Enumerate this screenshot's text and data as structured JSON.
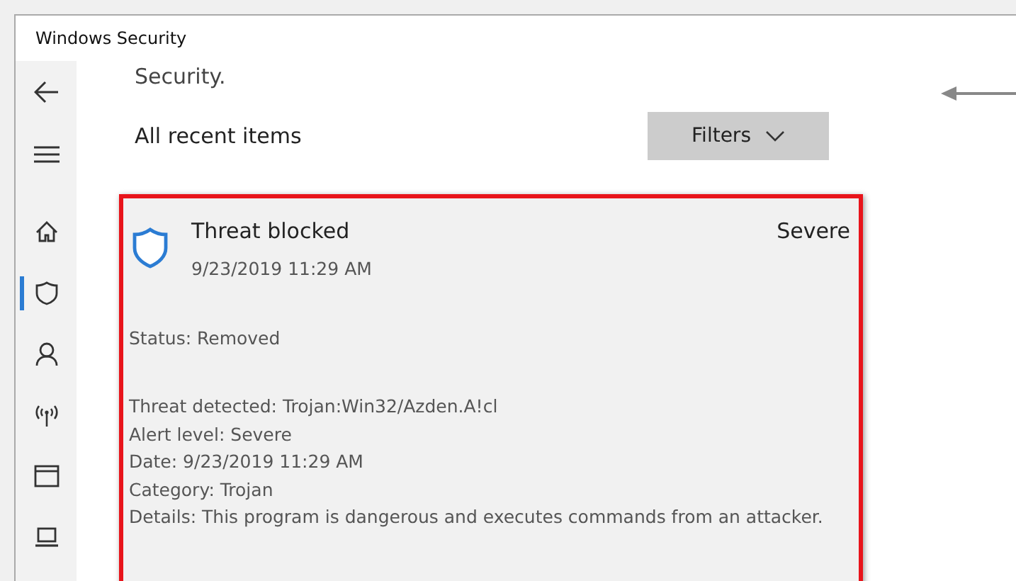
{
  "window": {
    "title": "Windows Security"
  },
  "sidebar": {
    "items": [
      {
        "kind": "home",
        "selected": false
      },
      {
        "kind": "shield",
        "selected": true
      },
      {
        "kind": "person",
        "selected": false
      },
      {
        "kind": "wireless",
        "selected": false
      },
      {
        "kind": "browser",
        "selected": false
      },
      {
        "kind": "laptop",
        "selected": false
      }
    ]
  },
  "page": {
    "intro_tail": "Security.",
    "section_title": "All recent items",
    "filters_button": "Filters"
  },
  "card": {
    "title": "Threat blocked",
    "time": "9/23/2019 11:29 AM",
    "severity": "Severe",
    "status": "Status:  Removed",
    "details": [
      "Threat detected:  Trojan:Win32/Azden.A!cl",
      "Alert level:  Severe",
      "Date:  9/23/2019 11:29 AM",
      "Category:  Trojan",
      "Details:  This program is dangerous and executes commands from an attacker."
    ]
  }
}
